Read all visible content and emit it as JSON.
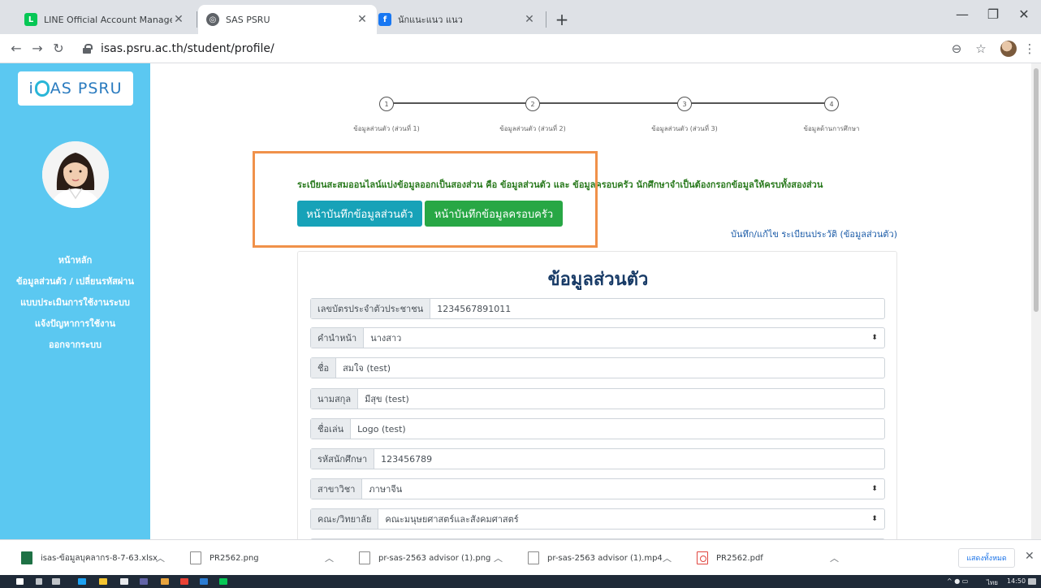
{
  "browser": {
    "tabs": [
      {
        "title": "LINE Official Account Manager",
        "icon": "line-icon",
        "color": "#06c755"
      },
      {
        "title": "SAS PSRU",
        "icon": "globe-icon",
        "color": "#5f6368"
      },
      {
        "title": "นักแนะแนว แนว",
        "icon": "facebook-icon",
        "color": "#1877f2"
      }
    ],
    "url": "isas.psru.ac.th/student/profile/"
  },
  "sidebar": {
    "logo_prefix": "i",
    "logo_suffix": "AS PSRU",
    "menu": [
      "หน้าหลัก",
      "ข้อมูลส่วนตัว / เปลี่ยนรหัสผ่าน",
      "แบบประเมินการใช้งานระบบ",
      "แจ้งปัญหาการใช้งาน",
      "ออกจากระบบ"
    ]
  },
  "steps": [
    {
      "num": "1",
      "label": "ข้อมูลส่วนตัว (ส่วนที่ 1)"
    },
    {
      "num": "2",
      "label": "ข้อมูลส่วนตัว (ส่วนที่ 2)"
    },
    {
      "num": "3",
      "label": "ข้อมูลส่วนตัว (ส่วนที่ 3)"
    },
    {
      "num": "4",
      "label": "ข้อมูลด้านการศึกษา"
    }
  ],
  "info_text": "ระเบียนสะสมออนไลน์แบ่งข้อมูลออกเป็นสองส่วน คือ ข้อมูลส่วนตัว และ ข้อมูลครอบครัว นักศึกษาจำเป็นต้องกรอกข้อมูลให้ครบทั้งสองส่วน",
  "buttons": {
    "personal": "หน้าบันทึกข้อมูลส่วนตัว",
    "family": "หน้าบันทึกข้อมูลครอบครัว"
  },
  "edit_link": "บันทึก/แก้ไข ระเบียนประวัติ (ข้อมูลส่วนตัว)",
  "form": {
    "title": "ข้อมูลส่วนตัว",
    "fields": [
      {
        "label": "เลขบัตรประจำตัวประชาชน",
        "value": "1234567891011",
        "select": false
      },
      {
        "label": "คำนำหน้า",
        "value": "นางสาว",
        "select": true
      },
      {
        "label": "ชื่อ",
        "value": "สมใจ (test)",
        "select": false
      },
      {
        "label": "นามสกุล",
        "value": "มีสุข (test)",
        "select": false
      },
      {
        "label": "ชื่อเล่น",
        "value": "Logo (test)",
        "select": false
      },
      {
        "label": "รหัสนักศึกษา",
        "value": "123456789",
        "select": false
      },
      {
        "label": "สาขาวิชา",
        "value": "ภาษาจีน",
        "select": true
      },
      {
        "label": "คณะ/วิทยาลัย",
        "value": "คณะมนุษยศาสตร์และสังคมศาสตร์",
        "select": true
      }
    ]
  },
  "downloads": [
    {
      "name": "isas-ข้อมูลบุคลากร-8-7-63.xlsx",
      "kind": "xlsx"
    },
    {
      "name": "PR2562.png",
      "kind": "file"
    },
    {
      "name": "pr-sas-2563 advisor (1).png",
      "kind": "file"
    },
    {
      "name": "pr-sas-2563 advisor (1).mp4",
      "kind": "file"
    },
    {
      "name": "PR2562.pdf",
      "kind": "pdf"
    }
  ],
  "downloads_show_all": "แสดงทั้งหมด",
  "taskbar": {
    "lang": "ไทย",
    "time": "14:50"
  },
  "colors": {
    "sidebar": "#5bc8f1",
    "btn_personal": "#17a2b8",
    "btn_family": "#28a745",
    "highlight": "#f0914a",
    "info_text": "#2a7a1e",
    "form_title": "#173a66"
  }
}
